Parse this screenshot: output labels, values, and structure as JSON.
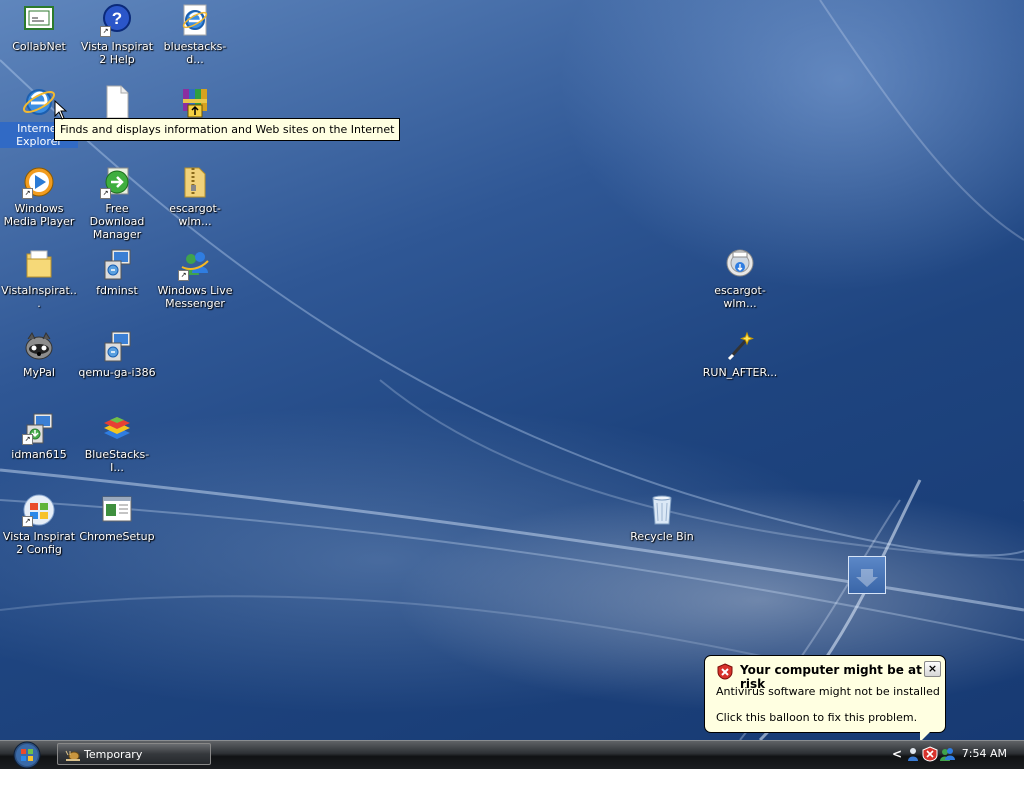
{
  "desktop": {
    "icons": [
      {
        "label": "CollabNet"
      },
      {
        "label": "Vista Inspirat 2 Help"
      },
      {
        "label": "bluestacks-d..."
      },
      {
        "label": "Internet Explorer"
      },
      {
        "label": ""
      },
      {
        "label": ""
      },
      {
        "label": "Windows Media Player"
      },
      {
        "label": "Free Download Manager"
      },
      {
        "label": "escargot-wlm..."
      },
      {
        "label": "VistaInspirat..."
      },
      {
        "label": "fdminst"
      },
      {
        "label": "Windows Live Messenger"
      },
      {
        "label": "MyPal"
      },
      {
        "label": "qemu-ga-i386"
      },
      {
        "label": "idman615"
      },
      {
        "label": "BlueStacks-I..."
      },
      {
        "label": "Vista Inspirat 2 Config"
      },
      {
        "label": "ChromeSetup"
      },
      {
        "label": "escargot-wlm..."
      },
      {
        "label": "RUN_AFTER..."
      },
      {
        "label": "Recycle Bin"
      }
    ]
  },
  "tooltip": {
    "text": "Finds and displays information and Web sites on the Internet"
  },
  "balloon": {
    "title": "Your computer might be at risk",
    "line1": "Antivirus software might not be installed",
    "line2": "Click this balloon to fix this problem.",
    "close_label": "×"
  },
  "taskbar": {
    "task_label": "Temporary Disposable...",
    "clock": "7:54 AM",
    "chevron": "<"
  }
}
